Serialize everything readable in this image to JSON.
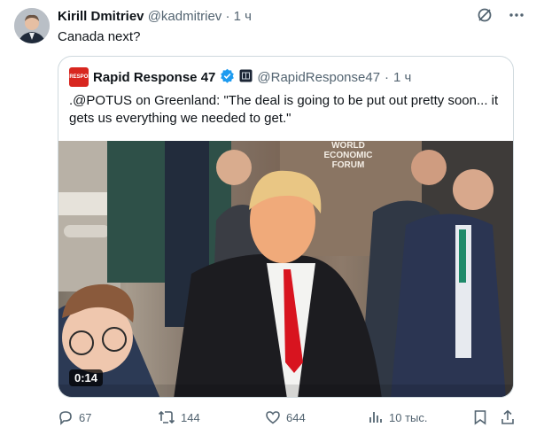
{
  "tweet": {
    "author_name": "Kirill Dmitriev",
    "handle": "@kadmitriev",
    "separator": "·",
    "time": "1 ч",
    "text": "Canada next?"
  },
  "quote": {
    "logo_text": "RAPID RESPONSE 47",
    "author_name": "Rapid Response 47",
    "handle": "@RapidResponse47",
    "separator": "·",
    "time": "1 ч",
    "text": ".@POTUS on Greenland: \"The deal is going to be put out pretty soon... it gets us everything we needed to get.\"",
    "media": {
      "banner_text": "WORLD ECONOMIC FORUM",
      "duration": "0:14"
    }
  },
  "actions": {
    "replies": "67",
    "reposts": "144",
    "likes": "644",
    "views": "10 тыс."
  },
  "icons": {
    "grok": "grok-icon",
    "more": "more-icon",
    "verified": "verified-badge-icon",
    "reply": "reply-icon",
    "repost": "repost-icon",
    "like": "like-icon",
    "views": "views-icon",
    "bookmark": "bookmark-icon",
    "share": "share-icon"
  },
  "colors": {
    "verified": "#1d9bf0",
    "text": "#0f1419",
    "muted": "#536471",
    "border": "#cfd9de"
  }
}
